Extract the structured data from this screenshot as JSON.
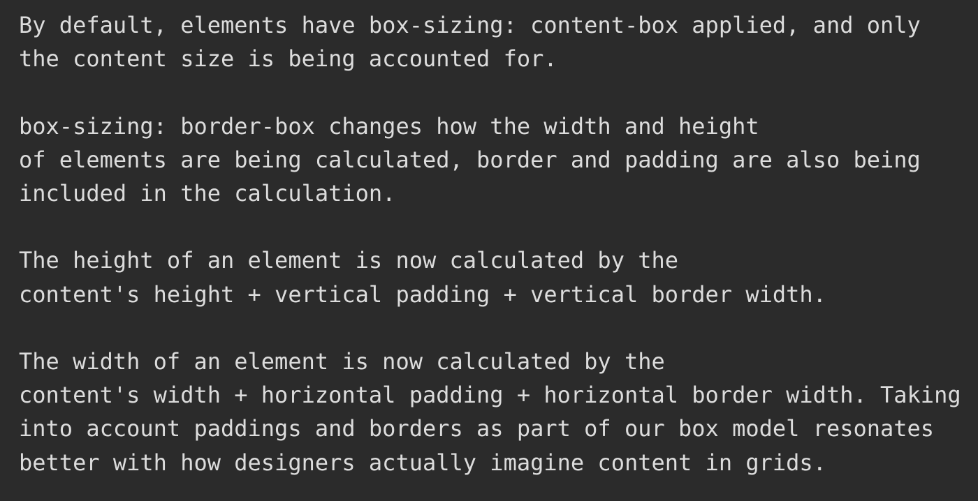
{
  "document": {
    "paragraphs": [
      {
        "lines": [
          "By default, elements have box-sizing: content-box applied, and only",
          "the content size is being accounted for."
        ]
      },
      {
        "lines": [
          "box-sizing: border-box changes how the width and height",
          "of elements are being calculated, border and padding are also being",
          "included in the calculation."
        ]
      },
      {
        "lines": [
          "The height of an element is now calculated by the",
          "content's height + vertical padding + vertical border width."
        ]
      },
      {
        "lines": [
          "The width of an element is now calculated by the",
          "content's width + horizontal padding + horizontal border width. Taking",
          "into account paddings and borders as part of our box model resonates",
          "better with how designers actually imagine content in grids."
        ]
      }
    ]
  },
  "colors": {
    "background": "#2b2b2b",
    "text": "#dcdcdc"
  }
}
